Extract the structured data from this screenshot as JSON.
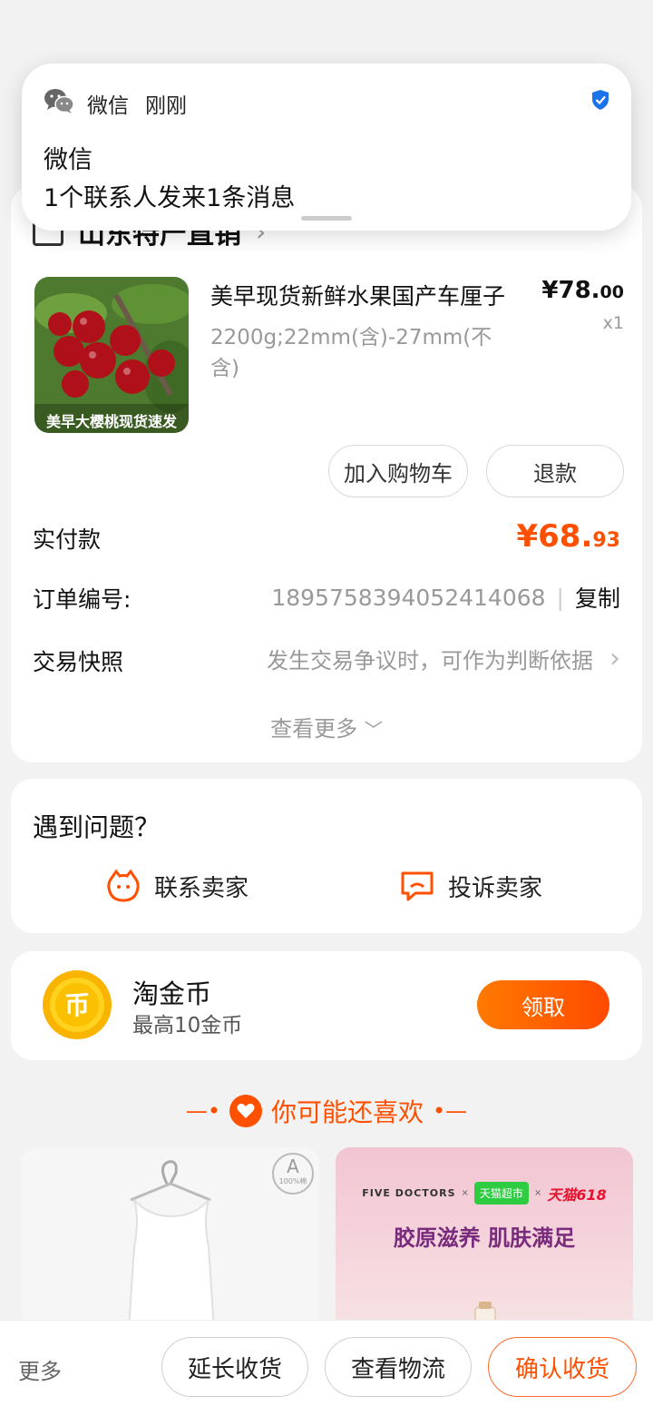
{
  "notification": {
    "app_name": "微信",
    "time": "刚刚",
    "title": "微信",
    "body": "1个联系人发来1条消息"
  },
  "order": {
    "shop_name": "山东特产直销",
    "product": {
      "image_caption": "美早大樱桃现货速发",
      "title": "美早现货新鲜水果国产车厘子",
      "spec": "2200g;22mm(含)-27mm(不含)",
      "price_int": "¥78.",
      "price_dec": "00",
      "quantity": "x1"
    },
    "actions": {
      "add_cart": "加入购物车",
      "refund": "退款"
    },
    "paid_label": "实付款",
    "paid_int": "¥68.",
    "paid_dec": "93",
    "order_no_label": "订单编号:",
    "order_no": "1895758394052414068",
    "copy_label": "复制",
    "snapshot_label": "交易快照",
    "snapshot_hint": "发生交易争议时，可作为判断依据",
    "see_more": "查看更多"
  },
  "help": {
    "title": "遇到问题？",
    "contact_seller": "联系卖家",
    "complain_seller": "投诉卖家"
  },
  "coins": {
    "title": "淘金币",
    "subtitle": "最高10金币",
    "claim": "领取"
  },
  "recommend": {
    "title": "你可能还喜欢",
    "left_badge": "A",
    "left_badge_sub": "100%棉",
    "ad_brand": "FIVE DOCTORS",
    "ad_tmall": "天猫超市",
    "ad_618": "天猫618",
    "ad_text": "胶原滋养 肌肤满足"
  },
  "bottom_bar": {
    "more": "更多",
    "extend": "延长收货",
    "logistics": "查看物流",
    "confirm": "确认收货"
  },
  "colors": {
    "accent": "#ff5000",
    "background": "#f2f2f2"
  }
}
